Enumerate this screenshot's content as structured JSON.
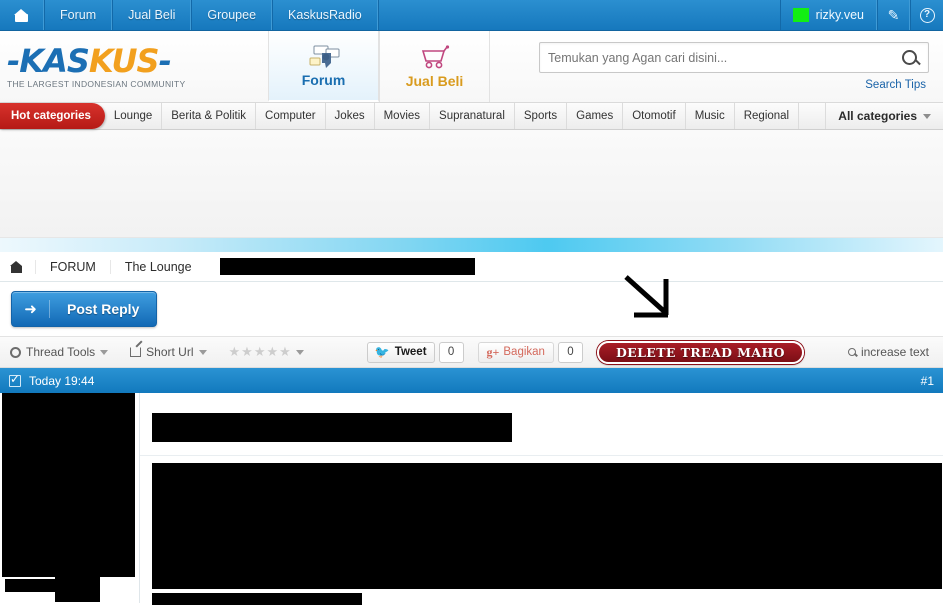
{
  "topbar": {
    "home_icon": "home-icon",
    "items": [
      {
        "label": "Forum"
      },
      {
        "label": "Jual Beli"
      },
      {
        "label": "Groupee"
      },
      {
        "label": "KaskusRadio"
      }
    ],
    "username": "rizky.veu",
    "user_status_color": "#12ef12",
    "edit_icon": "pencil-icon",
    "help_icon": "question-mark-icon"
  },
  "header": {
    "logo": {
      "part1": "KAS",
      "part2": "KUS",
      "dash": "-",
      "tagline": "THE LARGEST INDONESIAN COMMUNITY"
    },
    "tabs": [
      {
        "label": "Forum",
        "icon": "forum-chat-icon",
        "active": true
      },
      {
        "label": "Jual Beli",
        "icon": "shopping-cart-icon",
        "active": false
      }
    ],
    "search": {
      "placeholder": "Temukan yang Agan cari disini...",
      "value": "",
      "icon": "search-magnifier-icon",
      "tips_label": "Search Tips"
    }
  },
  "categories": {
    "hot_label": "Hot categories",
    "hot_color": "#c4211c",
    "items": [
      {
        "label": "Lounge"
      },
      {
        "label": "Berita & Politik"
      },
      {
        "label": "Computer"
      },
      {
        "label": "Jokes"
      },
      {
        "label": "Movies"
      },
      {
        "label": "Supranatural"
      },
      {
        "label": "Sports"
      },
      {
        "label": "Games"
      },
      {
        "label": "Otomotif"
      },
      {
        "label": "Music"
      },
      {
        "label": "Regional"
      }
    ],
    "all_label": "All categories"
  },
  "breadcrumb": {
    "home_icon": "home-icon",
    "items": [
      {
        "label": "FORUM"
      },
      {
        "label": "The Lounge"
      }
    ],
    "redacted": true
  },
  "actions": {
    "post_reply_label": "Post Reply",
    "post_reply_icon": "reply-arrow-icon",
    "annotation_icon": "diagonal-arrow-down-right"
  },
  "toolbar": {
    "thread_tools_label": "Thread Tools",
    "thread_tools_icon": "gear-icon",
    "short_url_label": "Short Url",
    "short_url_icon": "external-link-icon",
    "rating_stars": 5,
    "rating_filled": 0,
    "tweet_label": "Tweet",
    "tweet_icon": "twitter-bird-icon",
    "tweet_count": "0",
    "gplus_label": "Bagikan",
    "gplus_icon": "google-plus-icon",
    "gplus_count": "0",
    "delete_badge_label": "DELETE TREAD MAHO",
    "increase_text_label": "increase text",
    "increase_text_icon": "magnifier-icon"
  },
  "post": {
    "timestamp": "Today 19:44",
    "timestamp_icon": "checkbox-icon",
    "post_number": "#1",
    "author_redacted": true,
    "title_redacted": true,
    "content_redacted": true
  }
}
